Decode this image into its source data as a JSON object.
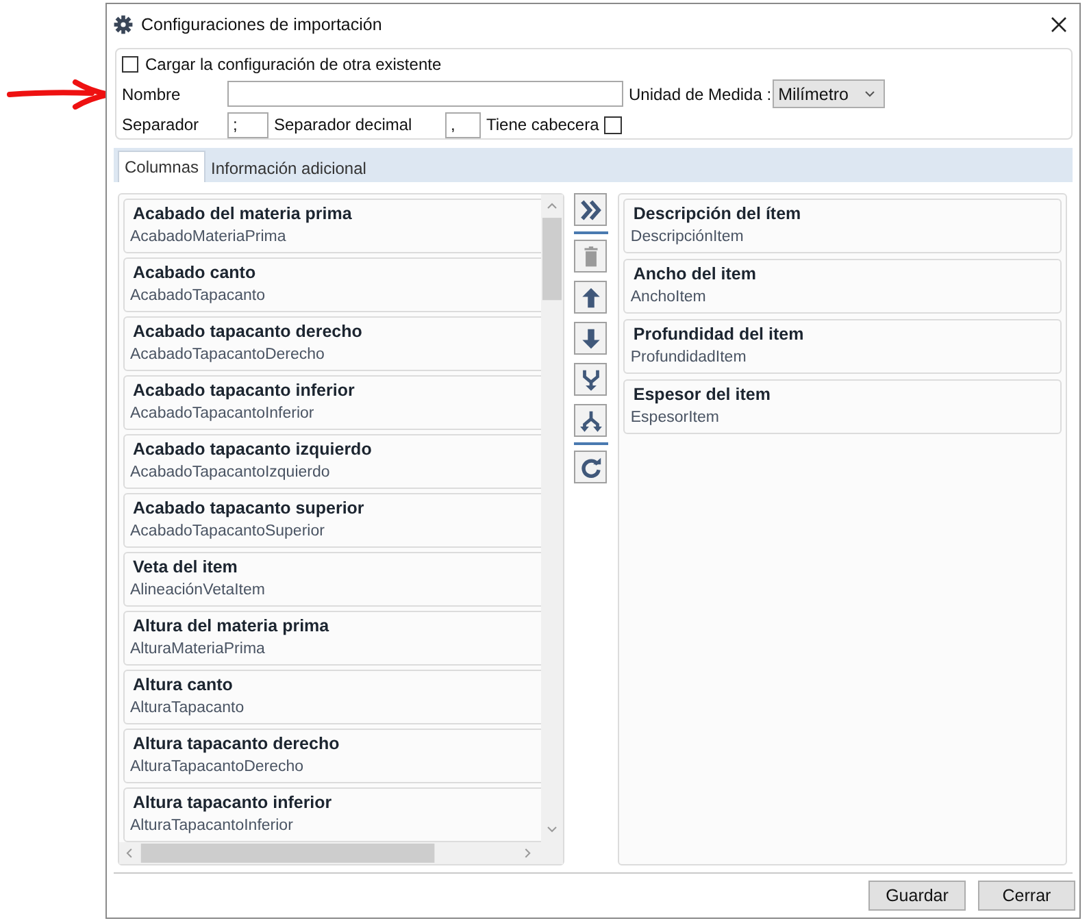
{
  "window": {
    "title": "Configuraciones de importación"
  },
  "options": {
    "load_existing": {
      "label": "Cargar la configuración de otra existente",
      "checked": false
    },
    "name": {
      "label": "Nombre"
    },
    "unit": {
      "label": "Unidad de Medida :",
      "value": "Milímetro"
    },
    "separator": {
      "label": "Separador",
      "value": ";"
    },
    "decimal_separator": {
      "label": "Separador decimal",
      "value": ","
    },
    "has_header": {
      "label": "Tiene cabecera",
      "checked": false
    }
  },
  "tabs": [
    {
      "label": "Columnas",
      "selected": true
    },
    {
      "label": "Información adicional",
      "selected": false
    }
  ],
  "available_columns": [
    {
      "title": "Acabado del materia prima",
      "field": "AcabadoMateriaPrima"
    },
    {
      "title": "Acabado canto",
      "field": "AcabadoTapacanto"
    },
    {
      "title": "Acabado tapacanto derecho",
      "field": "AcabadoTapacantoDerecho"
    },
    {
      "title": "Acabado tapacanto inferior",
      "field": "AcabadoTapacantoInferior"
    },
    {
      "title": "Acabado tapacanto izquierdo",
      "field": "AcabadoTapacantoIzquierdo"
    },
    {
      "title": "Acabado tapacanto superior",
      "field": "AcabadoTapacantoSuperior"
    },
    {
      "title": "Veta del item",
      "field": "AlineaciónVetaItem"
    },
    {
      "title": "Altura del materia prima",
      "field": "AlturaMateriaPrima"
    },
    {
      "title": "Altura canto",
      "field": "AlturaTapacanto"
    },
    {
      "title": "Altura tapacanto derecho",
      "field": "AlturaTapacantoDerecho"
    },
    {
      "title": "Altura tapacanto inferior",
      "field": "AlturaTapacantoInferior"
    }
  ],
  "tools": [
    {
      "kind": "add-all",
      "disabled": false
    },
    {
      "kind": "divider"
    },
    {
      "kind": "delete",
      "disabled": true
    },
    {
      "kind": "up",
      "disabled": false
    },
    {
      "kind": "down",
      "disabled": false
    },
    {
      "kind": "merge",
      "disabled": false
    },
    {
      "kind": "split",
      "disabled": false
    },
    {
      "kind": "divider"
    },
    {
      "kind": "refresh",
      "disabled": false
    }
  ],
  "selected_columns": [
    {
      "title": "Descripción del ítem",
      "field": "DescripciónItem"
    },
    {
      "title": "Ancho del item",
      "field": "AnchoItem"
    },
    {
      "title": "Profundidad del item",
      "field": "ProfundidadItem"
    },
    {
      "title": "Espesor del item",
      "field": "EspesorItem"
    }
  ],
  "buttons": [
    {
      "label": "Guardar"
    },
    {
      "label": "Cerrar"
    }
  ]
}
